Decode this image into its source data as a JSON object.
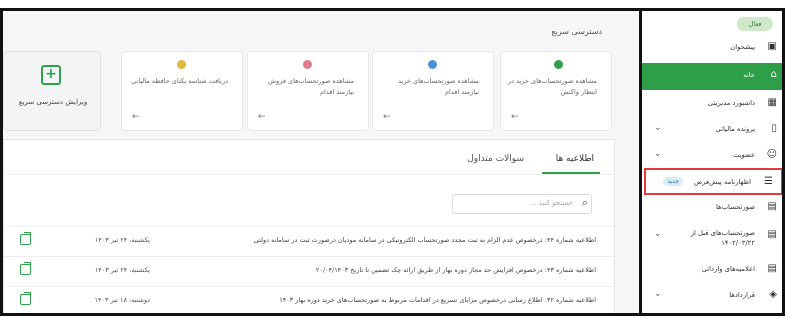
{
  "colors": {
    "accent": "#2f9e48",
    "highlight": "#e23b3b",
    "card1": "#2fa24b",
    "card2": "#4a8fd6",
    "card3": "#e27a8a",
    "card4": "#e0b83a"
  },
  "quick_access": {
    "title": "دسترسی سریع",
    "cards": [
      {
        "text": "مشاهده صورتحساب‌های خرید در انتظار واکنش",
        "icon": "circle-icon"
      },
      {
        "text": "مشاهده صورتحساب‌های خرید نیازمند اقدام",
        "icon": "circle-icon"
      },
      {
        "text": "مشاهده صورتحساب‌های فروش نیازمند اقدام",
        "icon": "circle-icon"
      },
      {
        "text": "دریافت شناسه یکتای حافظه مالیاتی",
        "icon": "circle-icon"
      }
    ],
    "edit_label": "ویرایش دسترسی سریع"
  },
  "tabs": {
    "announcements": "اطلاعیه ها",
    "faq": "سوالات متداول"
  },
  "search": {
    "placeholder": "جستجو کنید ..."
  },
  "announcements": [
    {
      "title": "اطلاعیه شماره ۴۴: درخصوص عدم الزام به ثبت مجدد صورتحساب الکترونیکی در سامانه مودیان درصورت ثبت در سامانه دولتی",
      "date": "یکشنبه، ۲۴ تیر ۱۴۰۳"
    },
    {
      "title": "اطلاعیه شماره ۴۳: درخصوص افزایش حد مجاز دوره بهار از طریق ارائه چک تضمین تا تاریخ ۲۰/۰۴/۱۴۰۳",
      "date": "یکشنبه، ۲۴ تیر ۱۴۰۳"
    },
    {
      "title": "اطلاعیه شماره ۴۲: اطلاع رسانی درخصوص مزایای تسریع در اقدامات مربوط به صورتحساب‌های خرید دوره بهار ۱۴۰۳",
      "date": "دوشنبه، ۱۸ تیر ۱۴۰۳"
    }
  ],
  "sidebar": {
    "user_badge": "فعال",
    "items": [
      {
        "label": "پیشخوان",
        "icon": "dashboard-icon"
      },
      {
        "label": "خانه",
        "icon": "home-icon"
      },
      {
        "label": "داشبورد مدیریتی",
        "icon": "grid-icon"
      },
      {
        "label": "پرونده مالیاتی",
        "icon": "file-icon"
      },
      {
        "label": "عضویت",
        "icon": "user-icon"
      },
      {
        "label": "اظهارنامه پیش‌فرض",
        "icon": "checklist-icon",
        "badge": "جدید"
      },
      {
        "label": "صورتحساب‌ها",
        "icon": "receipt-icon"
      },
      {
        "label": "صورتحساب‌های قبل از ۱۴۰۲/۰۳/۲۲",
        "icon": "receipt-icon"
      },
      {
        "label": "اعلامیه‌های وارداتی",
        "icon": "document-icon"
      },
      {
        "label": "قراردادها",
        "icon": "contract-icon"
      }
    ]
  }
}
